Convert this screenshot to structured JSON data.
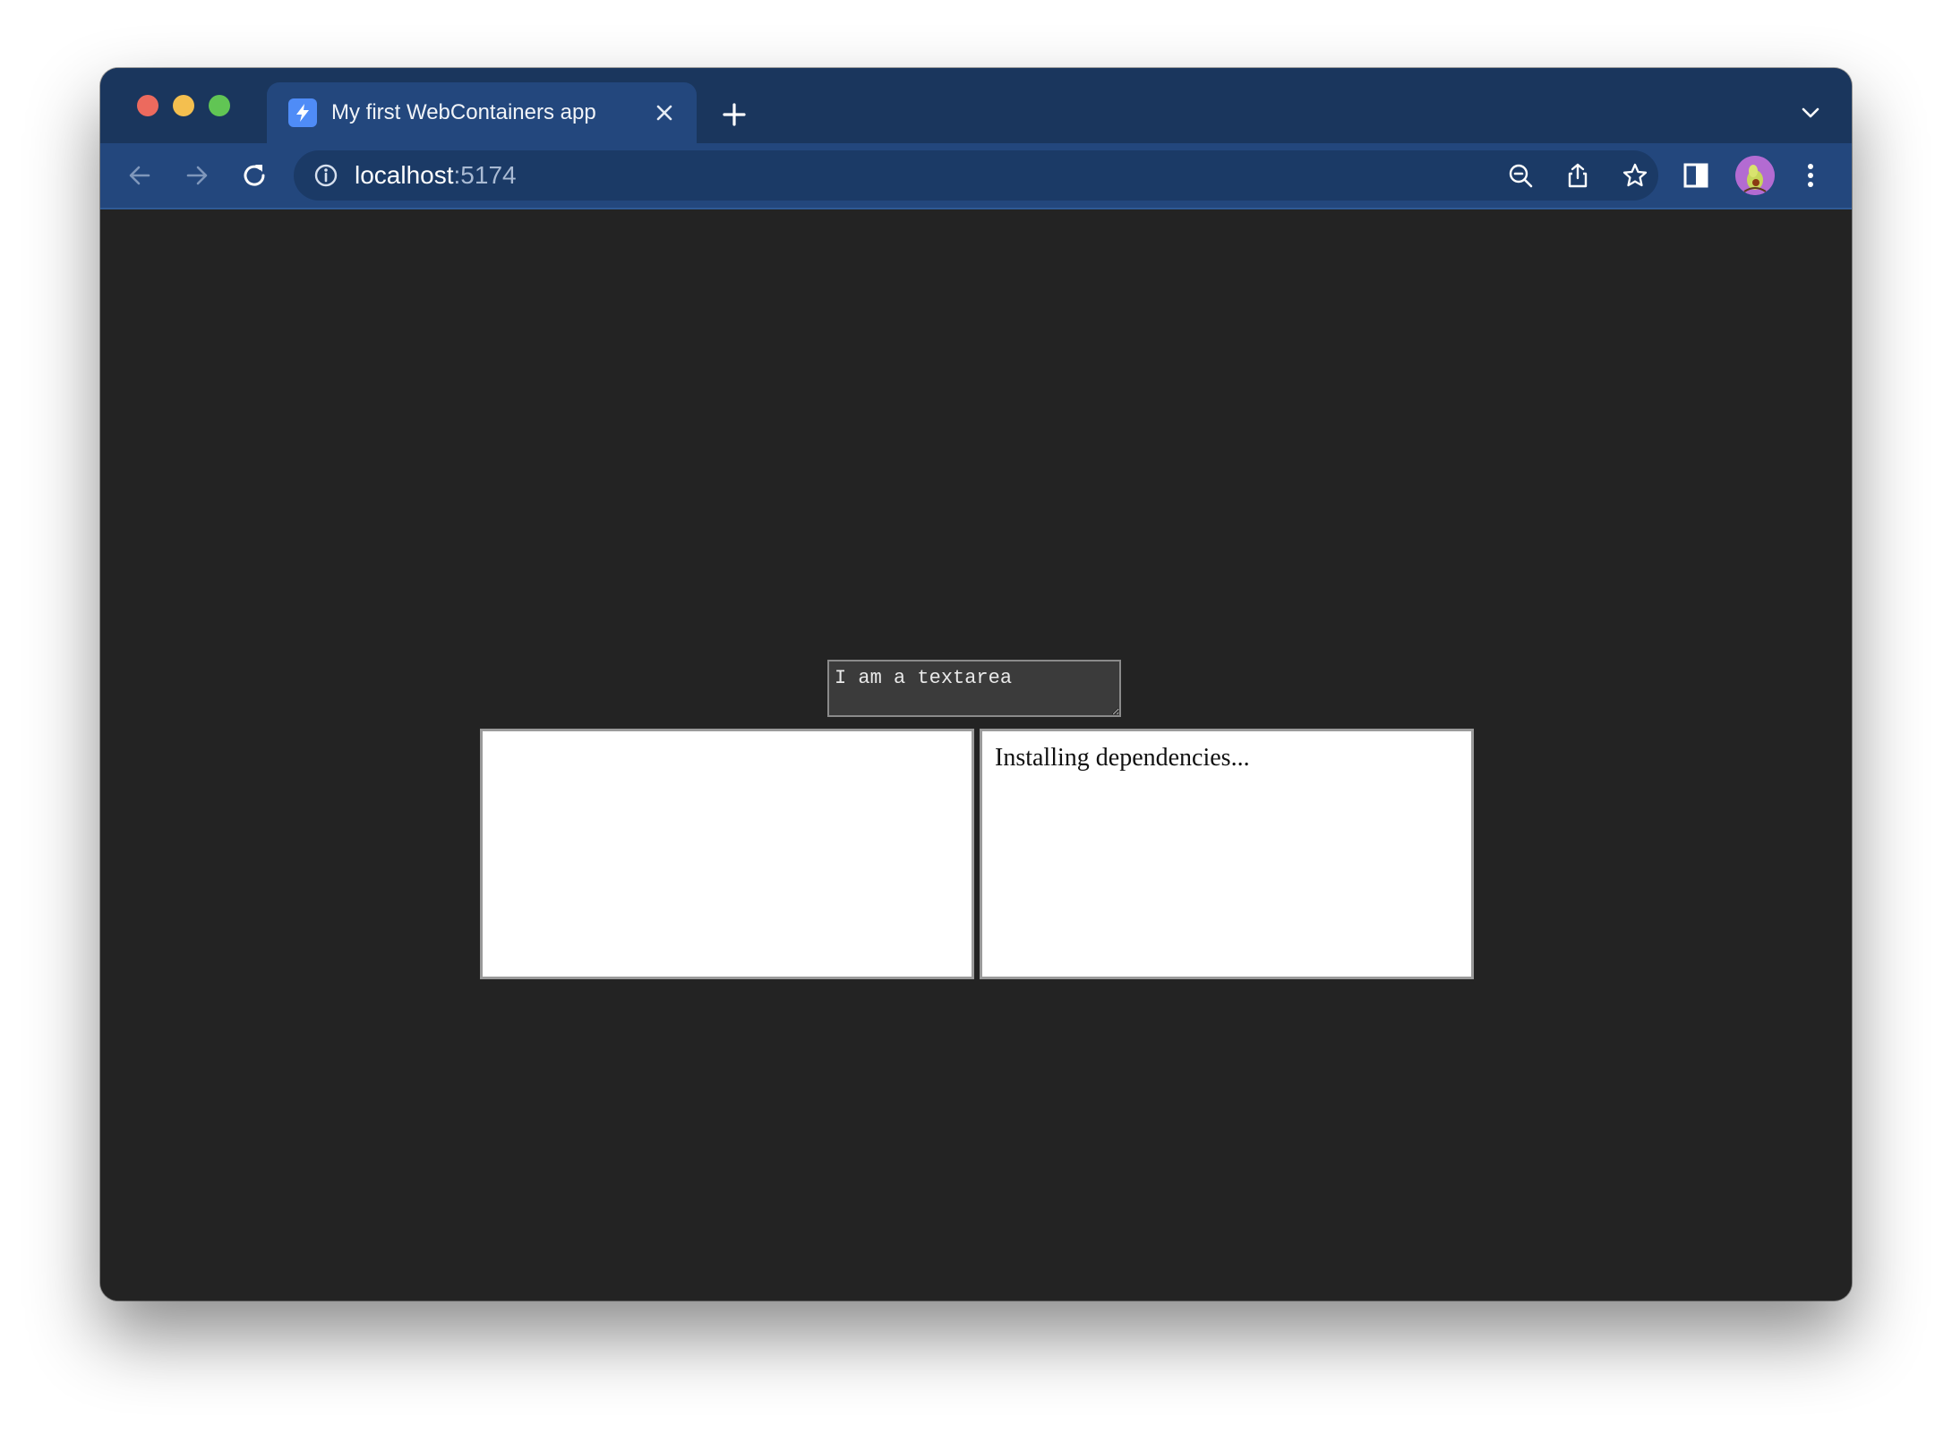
{
  "browser": {
    "tab": {
      "title": "My first WebContainers app",
      "favicon": "lightning-bolt-icon"
    },
    "address_bar": {
      "host": "localhost",
      "port": ":5174"
    },
    "icons": {
      "back": "arrow-left-icon",
      "forward": "arrow-right-icon",
      "reload": "reload-icon",
      "site_info": "info-icon",
      "zoom": "zoom-out-icon",
      "share": "share-icon",
      "bookmark": "star-icon",
      "side_panel": "side-panel-icon",
      "menu": "kebab-menu-icon",
      "new_tab": "plus-icon",
      "close_tab": "close-icon",
      "tab_search": "chevron-down-icon"
    },
    "colors": {
      "tabstrip": "#1a365d",
      "toolbar": "#23477d",
      "omnibox": "#1b3a66"
    }
  },
  "page": {
    "textarea": {
      "value": "I am a textarea"
    },
    "terminal": {
      "text": "Installing dependencies..."
    },
    "colors": {
      "background": "#232323",
      "textarea_background": "#3b3b3b"
    }
  }
}
